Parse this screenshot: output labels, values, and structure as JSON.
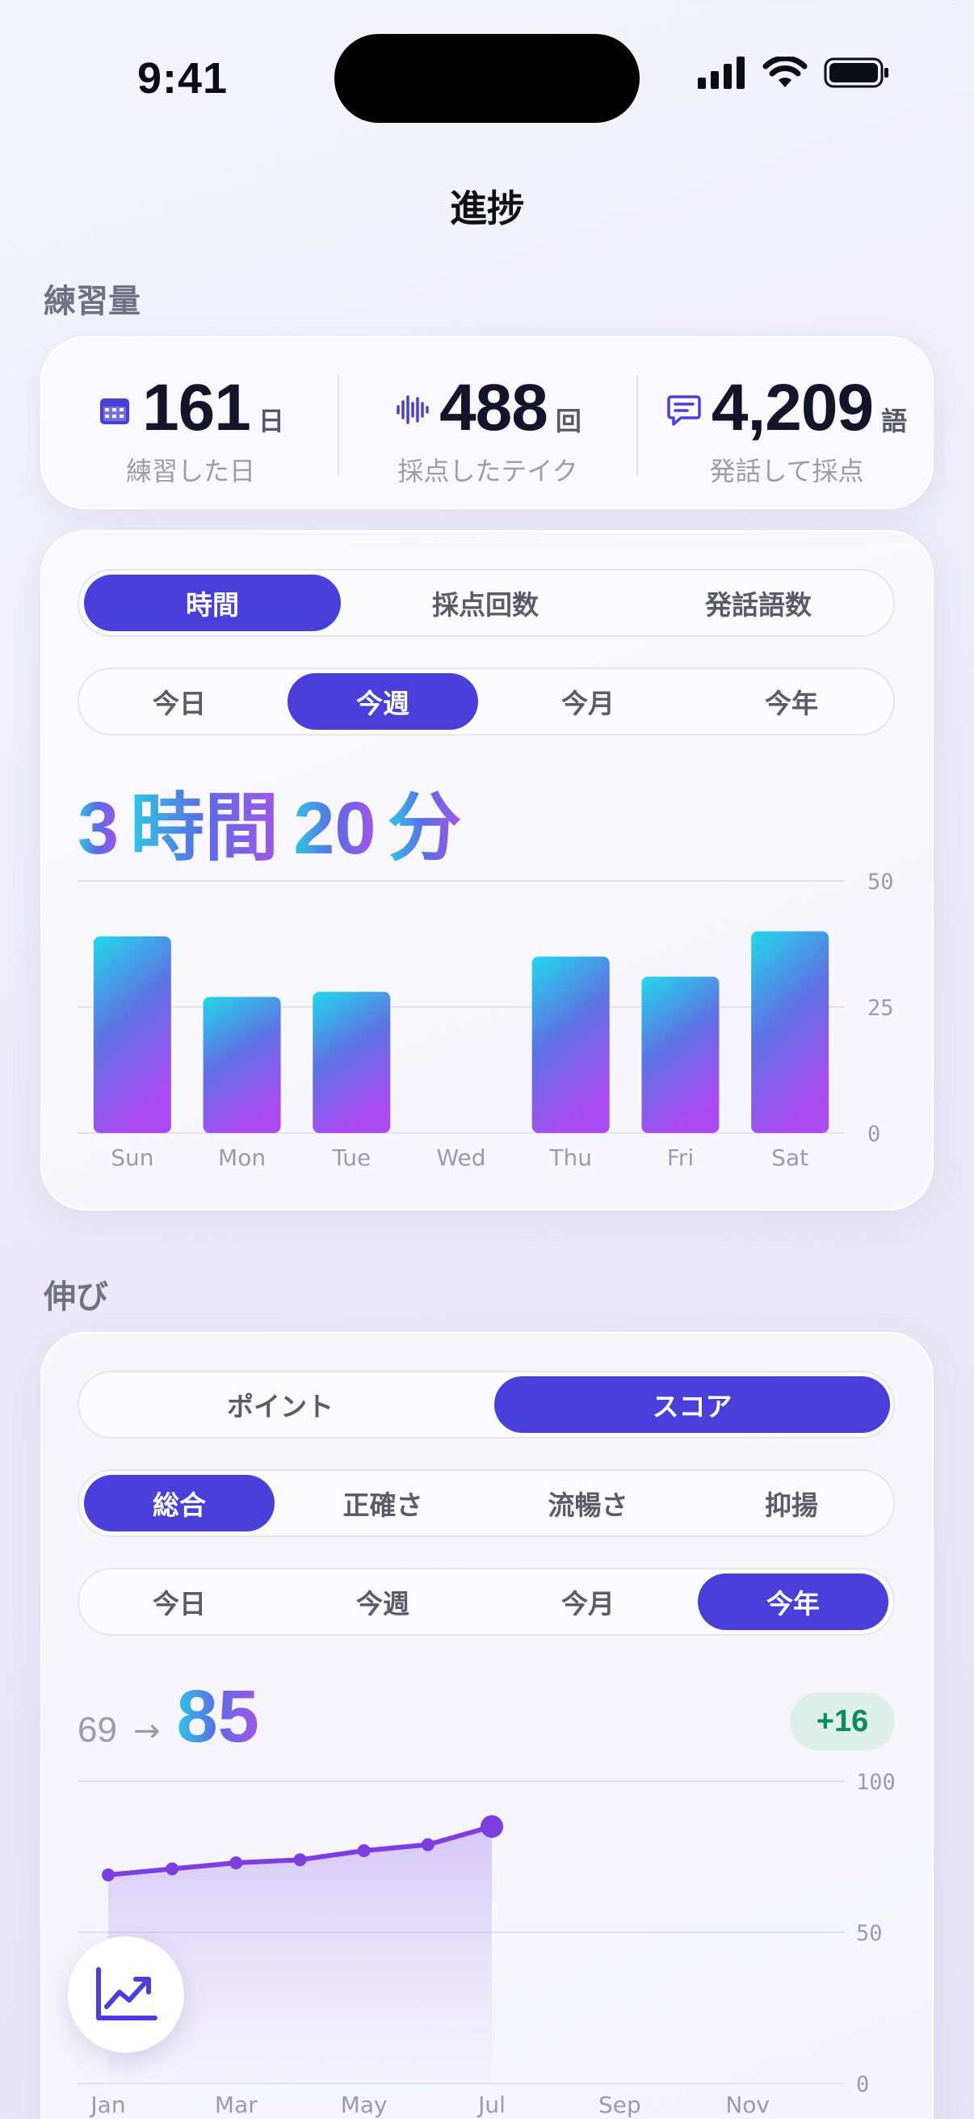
{
  "status_bar": {
    "time": "9:41"
  },
  "page": {
    "title": "進捗"
  },
  "practice": {
    "section_label": "練習量",
    "stats": [
      {
        "icon": "calendar-icon",
        "value": "161",
        "unit": "日",
        "label": "練習した日"
      },
      {
        "icon": "waveform-icon",
        "value": "488",
        "unit": "回",
        "label": "採点したテイク"
      },
      {
        "icon": "chat-icon",
        "value": "4,209",
        "unit": "語",
        "label": "発話して採点"
      }
    ],
    "metric_tabs": [
      "時間",
      "採点回数",
      "発話語数"
    ],
    "metric_active": 0,
    "period_tabs": [
      "今日",
      "今週",
      "今月",
      "今年"
    ],
    "period_active": 1,
    "total": {
      "hours": "3",
      "hours_unit": "時間",
      "minutes": "20",
      "minutes_unit": "分"
    }
  },
  "growth": {
    "section_label": "伸び",
    "mode_tabs": [
      "ポイント",
      "スコア"
    ],
    "mode_active": 1,
    "skill_tabs": [
      "総合",
      "正確さ",
      "流暢さ",
      "抑揚"
    ],
    "skill_active": 0,
    "period_tabs": [
      "今日",
      "今週",
      "今月",
      "今年"
    ],
    "period_active": 3,
    "score_from": "69",
    "score_arrow": "→",
    "score_to": "85",
    "delta": "+16"
  },
  "colors": {
    "accent": "#4a3fdb",
    "grad_start": "#2fd3e6",
    "grad_end": "#a64cf0",
    "line": "#7b3fe0",
    "delta_bg": "#dcefe9",
    "delta_text": "#0f8a5f"
  },
  "fab": {
    "icon": "trend-chart-icon"
  },
  "chart_data": [
    {
      "type": "bar",
      "categories": [
        "Sun",
        "Mon",
        "Tue",
        "Wed",
        "Thu",
        "Fri",
        "Sat"
      ],
      "values": [
        39,
        27,
        28,
        0,
        35,
        31,
        40
      ],
      "ylim": [
        0,
        50
      ],
      "yticks": [
        0,
        25,
        50
      ],
      "grid": true
    },
    {
      "type": "area",
      "categories": [
        "Jan",
        "Feb",
        "Mar",
        "Apr",
        "May",
        "Jun",
        "Jul",
        "Aug",
        "Sep",
        "Oct",
        "Nov",
        "Dec"
      ],
      "category_labels": [
        "Jan",
        "",
        "Mar",
        "",
        "May",
        "",
        "Jul",
        "",
        "Sep",
        "",
        "Nov",
        ""
      ],
      "values": [
        69,
        71,
        73,
        74,
        77,
        79,
        85
      ],
      "ylim": [
        0,
        100
      ],
      "yticks": [
        0,
        50,
        100
      ],
      "grid": true
    }
  ]
}
